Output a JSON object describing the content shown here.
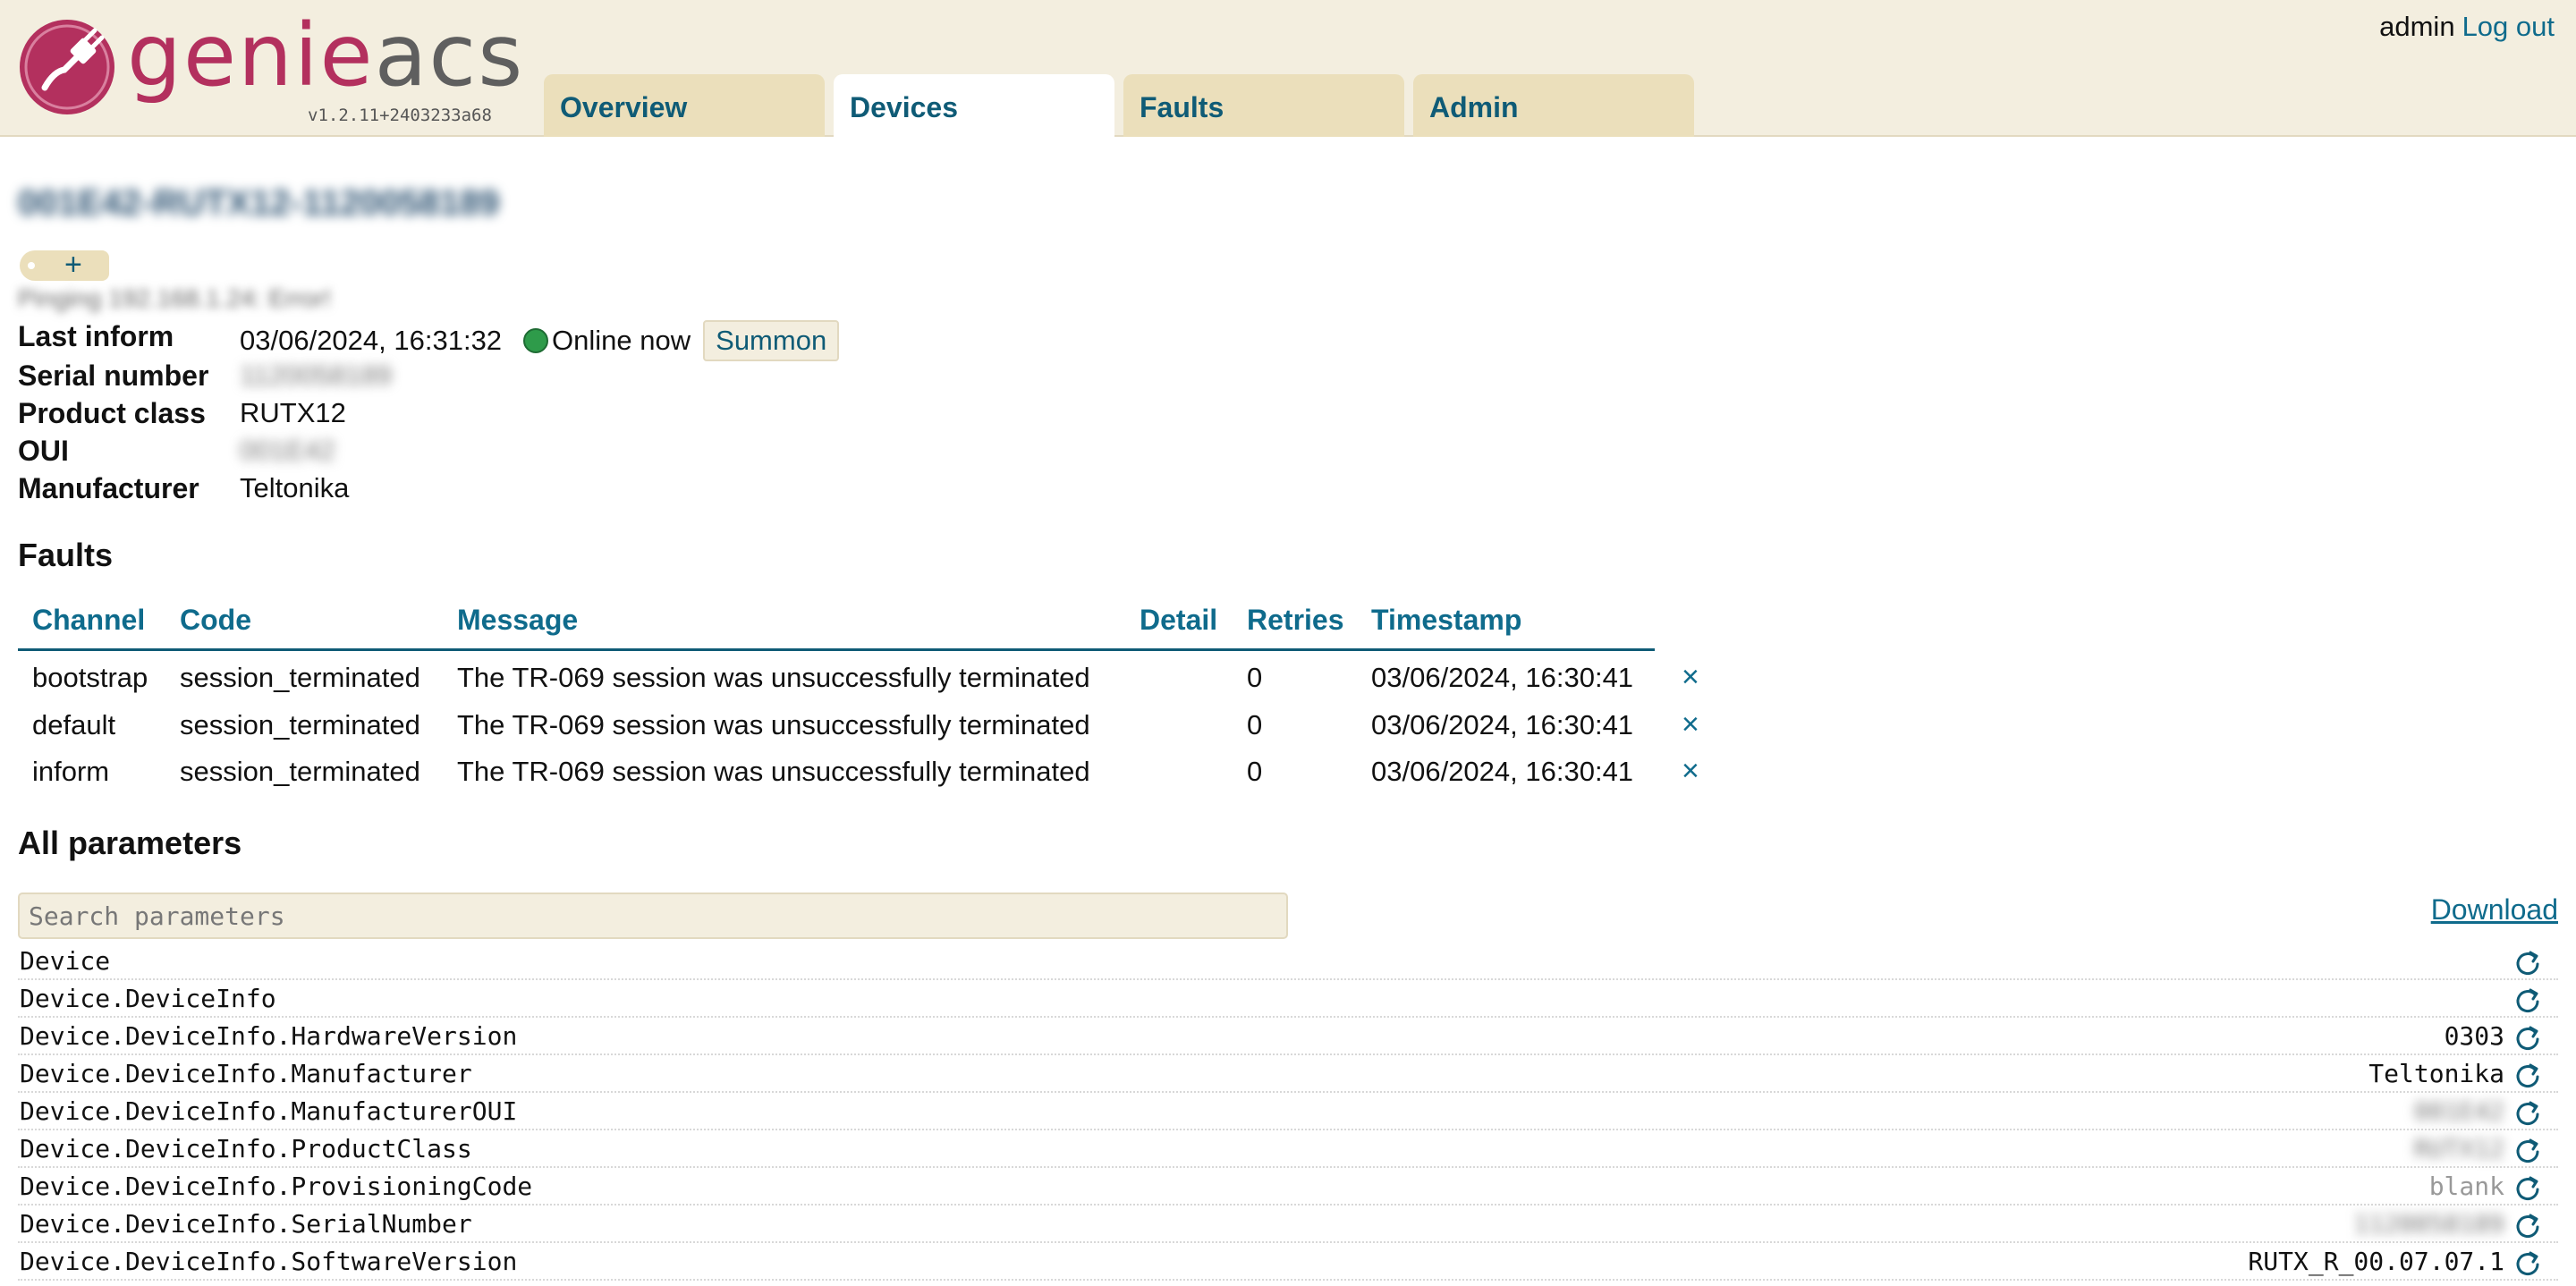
{
  "header": {
    "brand_part1": "genie",
    "brand_part2": "acs",
    "version": "v1.2.11+2403233a68",
    "tabs": [
      {
        "label": "Overview",
        "active": false
      },
      {
        "label": "Devices",
        "active": true
      },
      {
        "label": "Faults",
        "active": false
      },
      {
        "label": "Admin",
        "active": false
      }
    ],
    "username": "admin",
    "logout_label": "Log out"
  },
  "device": {
    "id": "001E42-RUTX12-1120058189",
    "add_tag_label": "+",
    "tags_line": "Pinging 192.168.1.24: Error!",
    "last_inform_label": "Last inform",
    "last_inform_value": "03/06/2024, 16:31:32",
    "online_status": "Online now",
    "summon_label": "Summon",
    "serial_label": "Serial number",
    "serial_value": "1120058189",
    "product_class_label": "Product class",
    "product_class_value": "RUTX12",
    "oui_label": "OUI",
    "oui_value": "001E42",
    "manufacturer_label": "Manufacturer",
    "manufacturer_value": "Teltonika"
  },
  "faults": {
    "title": "Faults",
    "columns": [
      "Channel",
      "Code",
      "Message",
      "Detail",
      "Retries",
      "Timestamp"
    ],
    "rows": [
      {
        "channel": "bootstrap",
        "code": "session_terminated",
        "message": "The TR-069 session was unsuccessfully terminated",
        "detail": "",
        "retries": "0",
        "timestamp": "03/06/2024, 16:30:41",
        "delete": "×"
      },
      {
        "channel": "default",
        "code": "session_terminated",
        "message": "The TR-069 session was unsuccessfully terminated",
        "detail": "",
        "retries": "0",
        "timestamp": "03/06/2024, 16:30:41",
        "delete": "×"
      },
      {
        "channel": "inform",
        "code": "session_terminated",
        "message": "The TR-069 session was unsuccessfully terminated",
        "detail": "",
        "retries": "0",
        "timestamp": "03/06/2024, 16:30:41",
        "delete": "×"
      }
    ]
  },
  "parameters": {
    "title": "All parameters",
    "search_placeholder": "Search parameters",
    "download_label": "Download",
    "rows": [
      {
        "name": "Device",
        "value": ""
      },
      {
        "name": "Device.DeviceInfo",
        "value": ""
      },
      {
        "name": "Device.DeviceInfo.HardwareVersion",
        "value": "0303"
      },
      {
        "name": "Device.DeviceInfo.Manufacturer",
        "value": "Teltonika"
      },
      {
        "name": "Device.DeviceInfo.ManufacturerOUI",
        "value": "001E42"
      },
      {
        "name": "Device.DeviceInfo.ProductClass",
        "value": "RUTX12"
      },
      {
        "name": "Device.DeviceInfo.ProvisioningCode",
        "value": "blank"
      },
      {
        "name": "Device.DeviceInfo.SerialNumber",
        "value": "1120058189"
      },
      {
        "name": "Device.DeviceInfo.SoftwareVersion",
        "value": "RUTX_R_00.07.07.1"
      }
    ]
  },
  "colors": {
    "header_bg": "#f3eedf",
    "tab_bg": "#ebdfbb",
    "link": "#0f6b8c",
    "brand_magenta": "#b3305e",
    "online": "#2e9b4a"
  }
}
